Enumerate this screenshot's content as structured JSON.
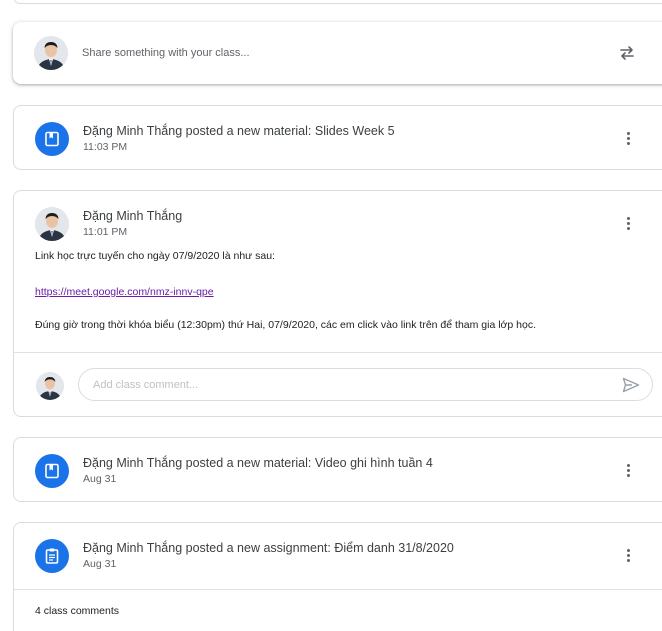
{
  "share": {
    "placeholder": "Share something with your class..."
  },
  "stream": [
    {
      "type": "material",
      "author": "Đặng Minh Thắng",
      "action": " posted a new material: ",
      "title": "Slides Week 5",
      "time": "11:03 PM"
    },
    {
      "type": "announcement",
      "author": "Đặng Minh Thắng",
      "time": "11:01 PM",
      "lines": [
        "Link học trực tuyến cho ngày 07/9/2020 là như sau:",
        "https://meet.google.com/nmz-innv-qpe",
        "Đúng giờ trong thời khóa biểu (12:30pm) thứ Hai, 07/9/2020, các em click vào link trên để tham gia lớp học."
      ],
      "comment_placeholder": "Add class comment..."
    },
    {
      "type": "material",
      "author": "Đặng Minh Thắng",
      "action": " posted a new material: ",
      "title": "Video ghi hình tuần 4",
      "time": "Aug 31"
    },
    {
      "type": "assignment",
      "author": "Đặng Minh Thắng",
      "action": " posted a new assignment: ",
      "title": "Điểm danh 31/8/2020",
      "time": "Aug 31",
      "comments_count": "4 class comments"
    }
  ],
  "icons": {
    "material": "bookmark-icon",
    "assignment": "assignment-icon",
    "more": "more-vert-icon",
    "repost": "repost-icon",
    "send": "send-icon"
  },
  "colors": {
    "accent": "#1a73e8",
    "link": "#681da8"
  }
}
